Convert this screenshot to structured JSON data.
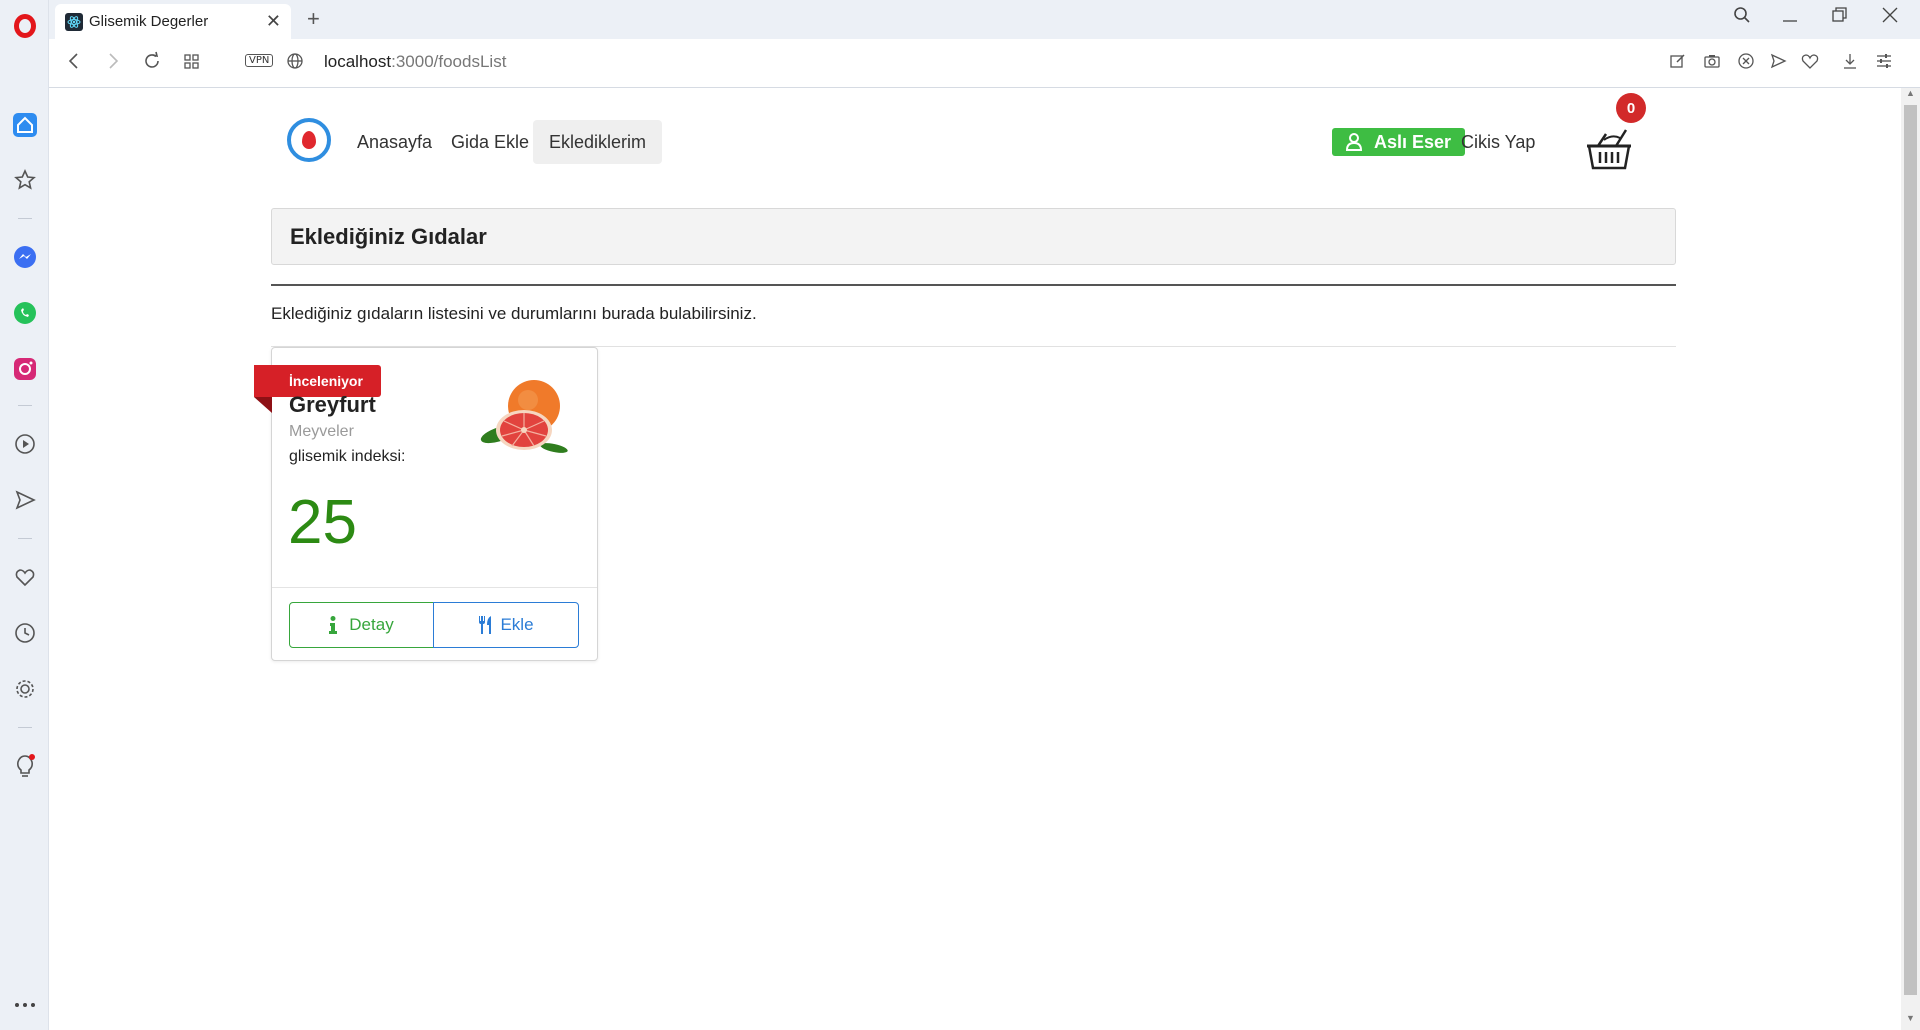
{
  "browser": {
    "tab_title": "Glisemik Degerler",
    "url_host": "localhost",
    "url_path": ":3000/foodsList",
    "vpn_label": "VPN"
  },
  "navbar": {
    "links": [
      "Anasayfa",
      "Gida Ekle",
      "Eklediklerim"
    ],
    "user_name": "Aslı Eser",
    "logout": "Cikis Yap",
    "cart_count": "0"
  },
  "page": {
    "title": "Eklediğiniz Gıdalar",
    "description": "Eklediğiniz gıdaların listesini ve durumlarını burada bulabilirsiniz."
  },
  "food_card": {
    "status": "İnceleniyor",
    "name": "Greyfurt",
    "category": "Meyveler",
    "gi_label": "glisemik indeksi:",
    "gi_value": "25",
    "detail_button": "Detay",
    "add_button": "Ekle"
  },
  "colors": {
    "status_red": "#d62027",
    "success_green": "#3ebd43",
    "primary_blue": "#2b7cd6"
  }
}
